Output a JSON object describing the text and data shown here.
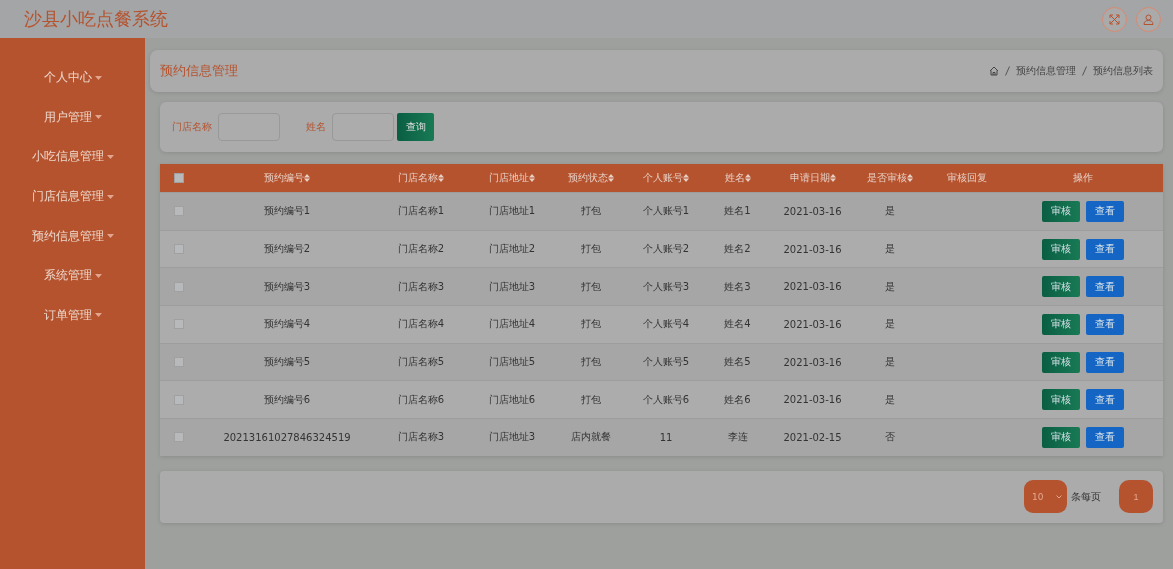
{
  "app": {
    "title": "沙县小吃点餐系统"
  },
  "sidebar": {
    "items": [
      {
        "label": "个人中心"
      },
      {
        "label": "用户管理"
      },
      {
        "label": "小吃信息管理"
      },
      {
        "label": "门店信息管理"
      },
      {
        "label": "预约信息管理"
      },
      {
        "label": "系统管理"
      },
      {
        "label": "订单管理"
      }
    ]
  },
  "page_header": {
    "title": "预约信息管理",
    "breadcrumb": [
      "预约信息管理",
      "预约信息列表"
    ]
  },
  "search": {
    "fields": [
      {
        "label": "门店名称"
      },
      {
        "label": "姓名"
      }
    ],
    "button": "查询"
  },
  "table": {
    "select_all_checked": false,
    "columns": [
      {
        "label": "预约编号",
        "sortable": true
      },
      {
        "label": "门店名称",
        "sortable": true
      },
      {
        "label": "门店地址",
        "sortable": true
      },
      {
        "label": "预约状态",
        "sortable": true
      },
      {
        "label": "个人账号",
        "sortable": true
      },
      {
        "label": "姓名",
        "sortable": true
      },
      {
        "label": "申请日期",
        "sortable": true
      },
      {
        "label": "是否审核",
        "sortable": true
      },
      {
        "label": "审核回复",
        "sortable": false
      },
      {
        "label": "操作",
        "sortable": false
      }
    ],
    "rows": [
      {
        "checked": false,
        "cells": [
          "预约编号1",
          "门店名称1",
          "门店地址1",
          "打包",
          "个人账号1",
          "姓名1",
          "2021-03-16",
          "是"
        ],
        "actions": [
          "审核",
          "查看"
        ]
      },
      {
        "checked": false,
        "cells": [
          "预约编号2",
          "门店名称2",
          "门店地址2",
          "打包",
          "个人账号2",
          "姓名2",
          "2021-03-16",
          "是"
        ],
        "actions": [
          "审核",
          "查看"
        ]
      },
      {
        "checked": false,
        "cells": [
          "预约编号3",
          "门店名称3",
          "门店地址3",
          "打包",
          "个人账号3",
          "姓名3",
          "2021-03-16",
          "是"
        ],
        "actions": [
          "审核",
          "查看"
        ]
      },
      {
        "checked": false,
        "cells": [
          "预约编号4",
          "门店名称4",
          "门店地址4",
          "打包",
          "个人账号4",
          "姓名4",
          "2021-03-16",
          "是"
        ],
        "actions": [
          "审核",
          "查看"
        ]
      },
      {
        "checked": false,
        "cells": [
          "预约编号5",
          "门店名称5",
          "门店地址5",
          "打包",
          "个人账号5",
          "姓名5",
          "2021-03-16",
          "是"
        ],
        "actions": [
          "审核",
          "查看"
        ]
      },
      {
        "checked": false,
        "cells": [
          "预约编号6",
          "门店名称6",
          "门店地址6",
          "打包",
          "个人账号6",
          "姓名6",
          "2021-03-16",
          "是"
        ],
        "actions": [
          "审核",
          "查看"
        ]
      },
      {
        "checked": false,
        "cells": [
          "20213161027846324519",
          "门店名称3",
          "门店地址3",
          "店内就餐",
          "11",
          "李连",
          "2021-02-15",
          "否"
        ],
        "actions": [
          "审核",
          "查看"
        ]
      }
    ]
  },
  "pagination": {
    "page_size": "10",
    "per_page_label": "条每页",
    "pages": [
      {
        "label": "1",
        "selected": true
      }
    ]
  }
}
